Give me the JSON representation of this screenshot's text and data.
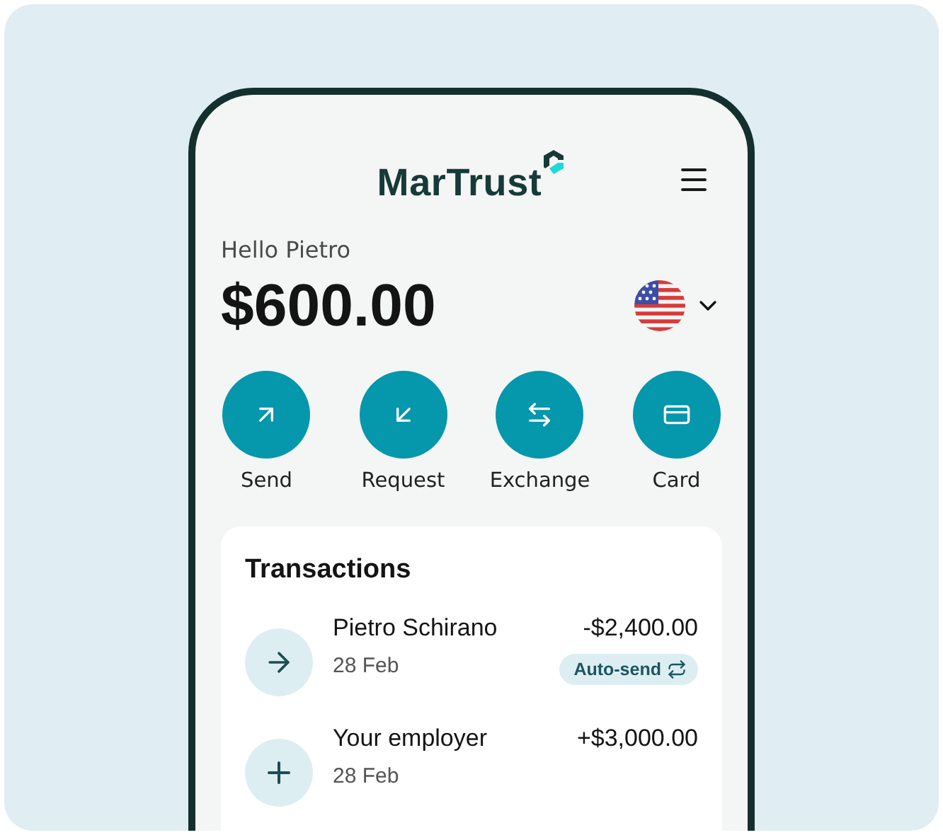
{
  "header": {
    "logo": "MarTrust"
  },
  "greeting": "Hello Pietro",
  "balance": {
    "amount": "$600.00"
  },
  "actions": [
    {
      "kind": "send",
      "label": "Send"
    },
    {
      "kind": "request",
      "label": "Request"
    },
    {
      "kind": "exchange",
      "label": "Exchange"
    },
    {
      "kind": "card",
      "label": "Card"
    }
  ],
  "transactions": {
    "title": "Transactions",
    "items": [
      {
        "kind": "outgoing",
        "name": "Pietro Schirano",
        "date": "28 Feb",
        "amount": "-$2,400.00",
        "badge": "Auto-send"
      },
      {
        "kind": "incoming",
        "name": "Your employer",
        "date": "28 Feb",
        "amount": "+$3,000.00"
      }
    ]
  }
}
